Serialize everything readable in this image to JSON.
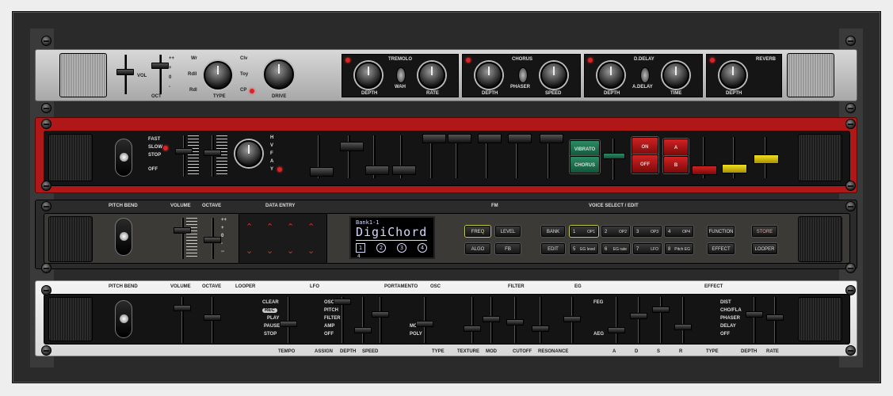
{
  "unit1": {
    "vol": "VOL",
    "oct_marks": [
      "++",
      "+",
      "0",
      "-"
    ],
    "oct": "OCT",
    "type_opts": [
      "Wr",
      "Rdll",
      "Rdl",
      "Clv",
      "Toy",
      "CP"
    ],
    "type": "TYPE",
    "drive": "DRIVE",
    "tremolo": {
      "title": "TREMOLO",
      "depth": "DEPTH",
      "wah": "WAH",
      "rate": "RATE"
    },
    "chorus": {
      "title": "CHORUS",
      "depth": "DEPTH",
      "phaser": "PHASER",
      "speed": "SPEED"
    },
    "ddelay": {
      "title": "D.DELAY",
      "depth": "DEPTH",
      "adelay": "A.DELAY",
      "time": "TIME"
    },
    "reverb": {
      "title": "REVERB",
      "depth": "DEPTH"
    }
  },
  "unit2": {
    "speed_opts": [
      "FAST",
      "SLOW",
      "STOP",
      "OFF"
    ],
    "vibrato": "VIBRATO",
    "chorus": "CHORUS",
    "wave_opts": [
      "H",
      "V",
      "F",
      "A",
      "Y"
    ],
    "on": "ON",
    "off": "OFF",
    "a": "A",
    "b": "B"
  },
  "unit3": {
    "pitch_bend": "PITCH BEND",
    "volume": "VOLUME",
    "octave": "OCTAVE",
    "oct_marks": [
      "++",
      "+",
      "0",
      "-",
      "--"
    ],
    "data_entry": "DATA ENTRY",
    "display": {
      "bank": "Bank1-1",
      "name": "DigiChord",
      "ops": [
        "1",
        "2",
        "3",
        "4"
      ],
      "sub": "4"
    },
    "fm": "FM",
    "fm_buttons": [
      "FREQ",
      "LEVEL",
      "ALGO",
      "FB"
    ],
    "voice_select": "VOICE SELECT / EDIT",
    "bank": "BANK",
    "edit": "EDIT",
    "op_buttons": [
      {
        "n": "1",
        "l": "OP1"
      },
      {
        "n": "2",
        "l": "OP2"
      },
      {
        "n": "3",
        "l": "OP3"
      },
      {
        "n": "4",
        "l": "OP4"
      }
    ],
    "edit_buttons": [
      {
        "n": "5",
        "l": "EG level"
      },
      {
        "n": "6",
        "l": "EG rate"
      },
      {
        "n": "7",
        "l": "LFO"
      },
      {
        "n": "8",
        "l": "Pitch EG"
      }
    ],
    "function": "FUNCTION",
    "store": "STORE",
    "effect": "EFFECT",
    "looper": "LOOPER"
  },
  "unit4": {
    "pitch_bend": "PITCH BEND",
    "volume": "VOLUME",
    "octave": "OCTAVE",
    "looper": "LOOPER",
    "looper_opts": [
      "CLEAR",
      "REC",
      "PLAY",
      "PAUSE",
      "STOP"
    ],
    "tempo": "TEMPO",
    "lfo": "LFO",
    "lfo_opts": [
      "OSC",
      "PITCH",
      "FILTER",
      "AMP",
      "OFF"
    ],
    "assign": "ASSIGN",
    "depth": "DEPTH",
    "speed": "SPEED",
    "portamento": "PORTAMENTO",
    "mono": "MONO",
    "poly": "POLY",
    "osc": "OSC",
    "type": "TYPE",
    "texture": "TEXTURE",
    "mod": "MOD",
    "filter": "FILTER",
    "cutoff": "CUTOFF",
    "resonance": "RESONANCE",
    "eg": "EG",
    "feg": "FEG",
    "aeg": "AEG",
    "adsr": [
      "A",
      "D",
      "S",
      "R"
    ],
    "effect": "EFFECT",
    "effect_opts": [
      "DIST",
      "CHO/FLA",
      "PHASER",
      "DELAY",
      "OFF"
    ],
    "etype": "TYPE",
    "edepth": "DEPTH",
    "rate": "RATE"
  },
  "colors": {
    "red_panel": "#b01818",
    "display_text": "#d8d8ff",
    "led_red": "#d22",
    "green_btn": "#1e6e4e",
    "yellow_btn": "#e8d000"
  }
}
